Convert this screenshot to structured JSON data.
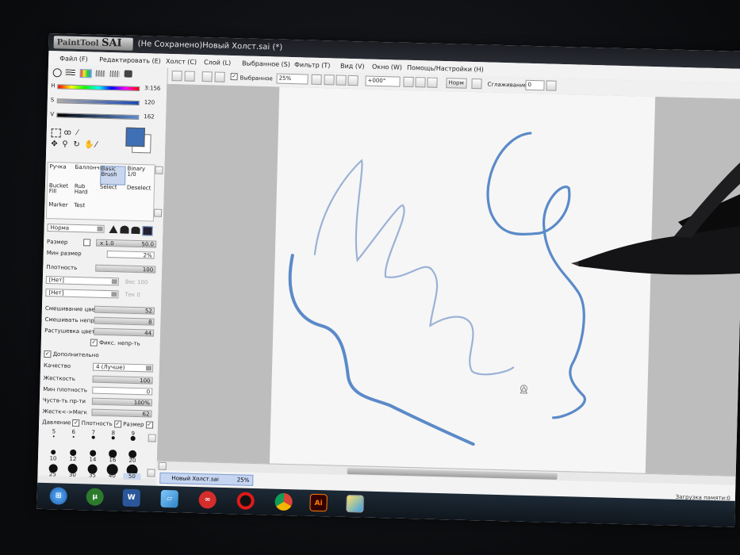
{
  "window": {
    "logo_small": "PaintTool",
    "logo_big": "SAI",
    "title": "(Не Сохранено)Новый Холст.sai (*)"
  },
  "menu": [
    "Файл (F)",
    "Редактировать (E)",
    "Холст (C)",
    "Слой (L)",
    "Выбранное (S)",
    "Фильтр (T)",
    "Вид (V)",
    "Окно (W)",
    "Помощь/Настройки (H)"
  ],
  "toolbar": {
    "selection_label": "Выбранное",
    "zoom": "25%",
    "angle": "+000°",
    "blend_mode": "Норм",
    "smoothing_label": "Сглаживание",
    "smoothing_value": "0"
  },
  "color": {
    "h_label": "H",
    "h_value": "3:156",
    "s_label": "S",
    "s_value": "120",
    "v_label": "V",
    "v_value": "162",
    "current": "#3f6fb5"
  },
  "tools": [
    {
      "label": "Ручка"
    },
    {
      "label": "Баллончик"
    },
    {
      "label": "Basic Brush"
    },
    {
      "label": "Binary 1/0"
    },
    {
      "label": "Bucket Fill"
    },
    {
      "label": "Rub Hard"
    },
    {
      "label": "Select"
    },
    {
      "label": "Deselect"
    },
    {
      "label": "Marker"
    },
    {
      "label": "Test"
    }
  ],
  "brush": {
    "mode": "Норма",
    "size_label": "Размер",
    "size_mult": "x 1.0",
    "size_value": "50.0",
    "min_size_label": "Мин размер",
    "min_size_value": "2%",
    "density_label": "Плотность",
    "density_value": "100",
    "texture1": "[Нет]",
    "texture1_side": "Вес 100",
    "texture2": "[Нет]",
    "texture2_side": "Тек 0",
    "blend_label": "Смешивание цве",
    "blend_value": "52",
    "dilution_label": "Смешивать непр",
    "dilution_value": "8",
    "persistence_label": "Растушевка цвет",
    "persistence_value": "44",
    "fix_label": "Фикс. непр-ть",
    "extra_label": "Дополнительно",
    "quality_label": "Качество",
    "quality_value": "4 (Лучше)",
    "hardness_label": "Жесткость",
    "hardness_value": "100",
    "min_density_label": "Мин плотность",
    "min_density_value": "0",
    "sens_label": "Чуств-ть пр-ти",
    "sens_value": "100%",
    "hard_soft_label": "Жестк<->Мягк",
    "hard_soft_value": "62",
    "pressure_label": "Давление",
    "pressure_density": "Плотность",
    "pressure_size": "Размер"
  },
  "brush_sizes": [
    "5",
    "6",
    "7",
    "8",
    "9",
    "10",
    "12",
    "14",
    "16",
    "20",
    "25",
    "30",
    "35",
    "40",
    "50"
  ],
  "status": {
    "doc_tab": "Новый Холст.sai",
    "doc_zoom": "25%",
    "right": "Загрузка памяти:0"
  },
  "taskbar": {
    "word": "W",
    "illustrator": "Ai"
  }
}
